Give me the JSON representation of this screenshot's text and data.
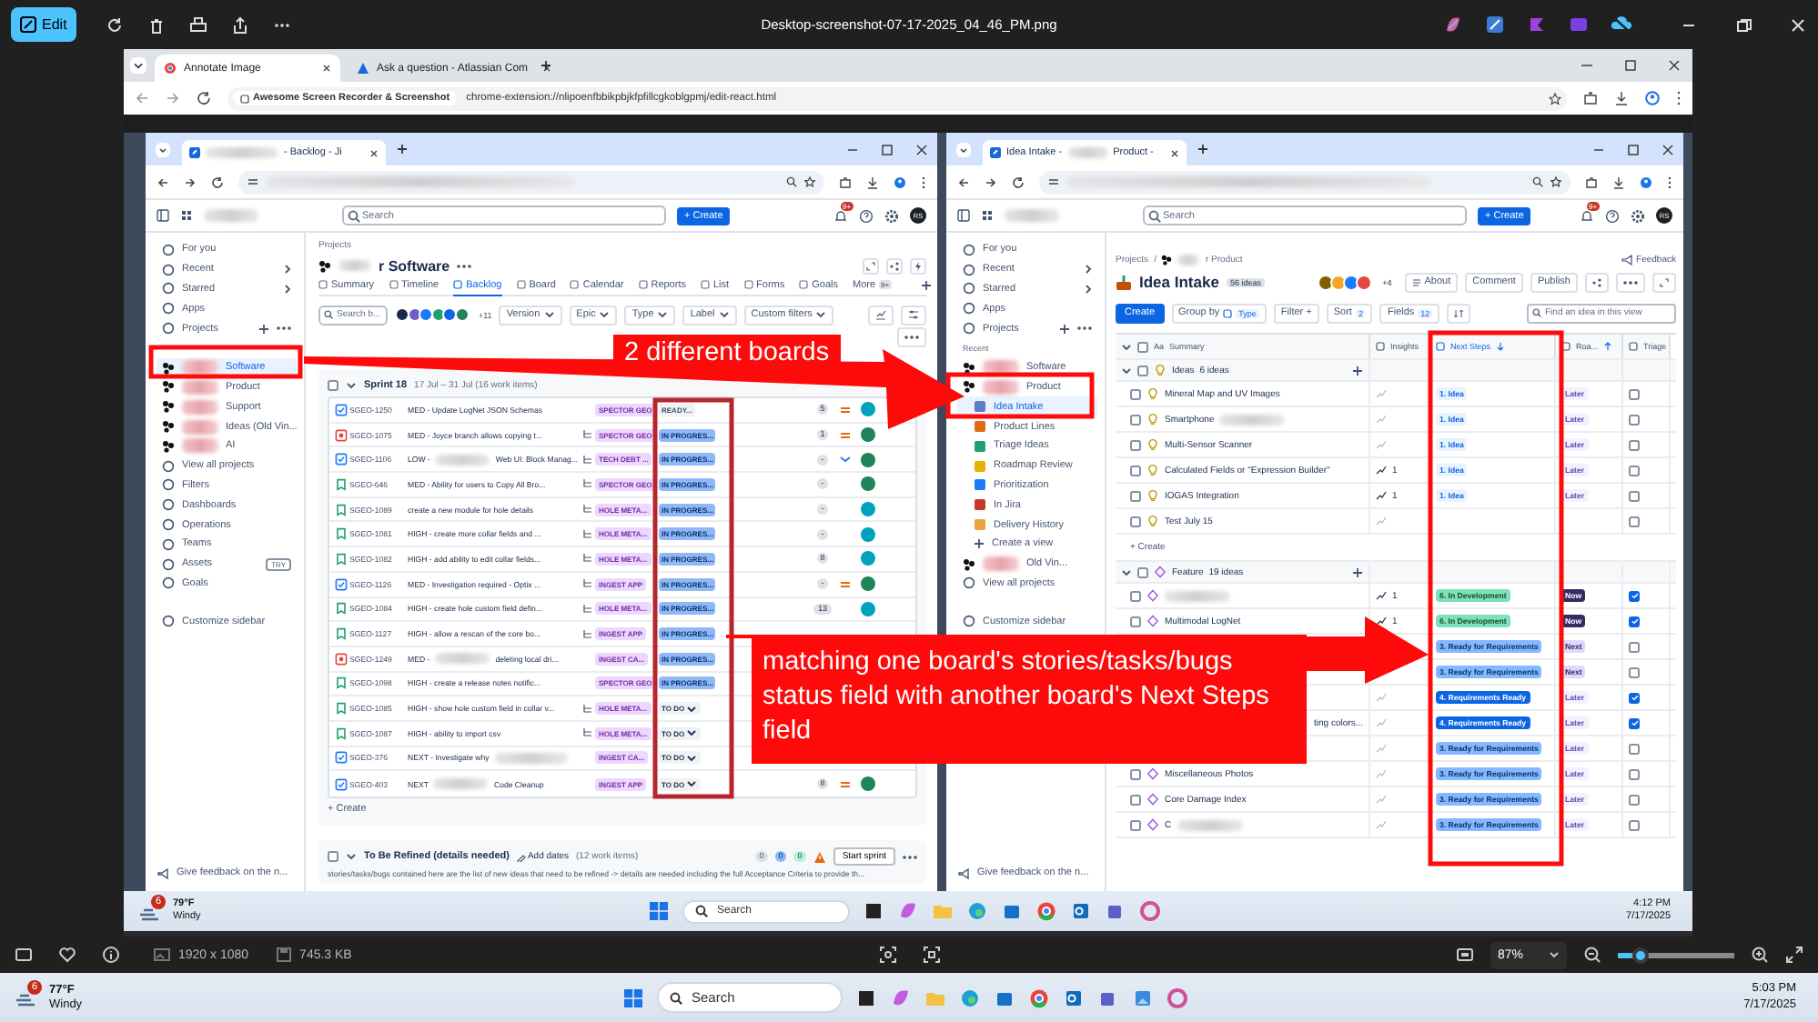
{
  "viewer": {
    "edit_button": "Edit",
    "title": "Desktop-screenshot-07-17-2025_04_46_PM.png",
    "dimensions": "1920 x 1080",
    "file_size": "745.3 KB",
    "zoom": "87%",
    "zoom_slider": {
      "level": 0.12
    }
  },
  "browser": {
    "tabs": [
      {
        "label": "Annotate Image",
        "selected": true
      },
      {
        "label": "Ask a question - Atlassian Com",
        "selected": false
      }
    ],
    "site_chip": "Awesome Screen Recorder & Screenshot",
    "url": "chrome-extension://nlipoenfbbikpbjkfpfillcgkoblgpmj/edit-react.html"
  },
  "left_window": {
    "tab_title": "- Backlog - Ji",
    "search": {
      "placeholder": "Search"
    },
    "create_button": "+ Create",
    "notification_count": "9+",
    "user_initials": "RS",
    "sidebar": [
      {
        "label": "For you",
        "kind": "link",
        "selected": false
      },
      {
        "label": "Recent",
        "kind": "menu",
        "selected": false
      },
      {
        "label": "Starred",
        "kind": "menu",
        "selected": false
      },
      {
        "label": "Apps",
        "kind": "link",
        "selected": false
      },
      {
        "label": "Projects",
        "kind": "section",
        "selected": false
      },
      {
        "label": "Software",
        "kind": "project",
        "selected": true
      },
      {
        "label": "Product",
        "kind": "project",
        "selected": false
      },
      {
        "label": "Support",
        "kind": "project",
        "selected": false
      },
      {
        "label": "Ideas (Old Vin...",
        "kind": "project",
        "selected": false
      },
      {
        "label": "AI",
        "kind": "project",
        "selected": false
      },
      {
        "label": "View all projects",
        "kind": "link",
        "selected": false
      },
      {
        "label": "Filters",
        "kind": "link",
        "selected": false
      },
      {
        "label": "Dashboards",
        "kind": "link",
        "selected": false
      },
      {
        "label": "Operations",
        "kind": "link",
        "selected": false
      },
      {
        "label": "Teams",
        "kind": "link",
        "selected": false
      },
      {
        "label": "Assets",
        "kind": "link",
        "badge": "TRY",
        "selected": false
      },
      {
        "label": "Goals",
        "kind": "link",
        "selected": false
      },
      {
        "label": "Customize sidebar",
        "kind": "link",
        "selected": false
      }
    ],
    "feedback": "Give feedback on the n...",
    "breadcrumb": "Projects",
    "project_title": "r Software",
    "tabs": [
      {
        "label": "Summary",
        "selected": false
      },
      {
        "label": "Timeline",
        "selected": false
      },
      {
        "label": "Backlog",
        "selected": true
      },
      {
        "label": "Board",
        "selected": false
      },
      {
        "label": "Calendar",
        "selected": false
      },
      {
        "label": "Reports",
        "selected": false
      },
      {
        "label": "List",
        "selected": false
      },
      {
        "label": "Forms",
        "selected": false
      },
      {
        "label": "Goals",
        "selected": false
      }
    ],
    "more_tab": {
      "label": "More",
      "badge": "9+"
    },
    "backlog_search": {
      "placeholder": "Search b..."
    },
    "avatars": [
      {
        "color": "#172b4d"
      },
      {
        "color": "#6e5dc6"
      },
      {
        "color": "#1d7afc"
      },
      {
        "color": "#22a06b"
      },
      {
        "color": "#0c66e4"
      },
      {
        "color": "#1f845a"
      }
    ],
    "avatar_overflow": "+11",
    "filters": [
      "Version",
      "Epic",
      "Type",
      "Label",
      "Custom filters"
    ],
    "sprint": {
      "name": "Sprint 18",
      "checked": false,
      "dates": "17 Jul – 31 Jul (16 work items)",
      "create": "+ Create",
      "rows": [
        {
          "kind": "task",
          "key": "SGEO-1250",
          "summary": "MED - Update LogNet JSON Schemas",
          "child_items": false,
          "epic": "SPECTOR GEO",
          "status": {
            "label": "READY...",
            "kind": "ready"
          },
          "estimate": "5",
          "priority": {
            "kind": "medium"
          },
          "assignee": {
            "color": "#00a3bf"
          }
        },
        {
          "kind": "bug",
          "key": "SGEO-1075",
          "summary": "MED - Joyce branch allows copying t...",
          "child_items": true,
          "epic": "SPECTOR GEO",
          "status": {
            "label": "IN PROGRES...",
            "kind": "inprogress"
          },
          "estimate": "1",
          "priority": {
            "kind": "medium"
          },
          "assignee": {
            "color": "#1f845a"
          }
        },
        {
          "kind": "task",
          "key": "SGEO-1106",
          "summary": "LOW -",
          "summary_tail": "Web UI: Block Manag...",
          "child_items": true,
          "epic": "TECH DEBT ...",
          "status": {
            "label": "IN PROGRES...",
            "kind": "inprogress"
          },
          "estimate": "-",
          "priority": {
            "kind": "low"
          },
          "assignee": {
            "color": "#1f845a"
          }
        },
        {
          "kind": "story",
          "key": "SGEO-646",
          "summary": "MED - Ability for users to Copy All Bro...",
          "child_items": true,
          "epic": "SPECTOR GEO",
          "status": {
            "label": "IN PROGRES...",
            "kind": "inprogress"
          },
          "estimate": "-",
          "assignee": {
            "color": "#1f845a"
          }
        },
        {
          "kind": "story",
          "key": "SGEO-1089",
          "summary": "create a new module for hole details",
          "child_items": true,
          "epic": "HOLE META...",
          "status": {
            "label": "IN PROGRES...",
            "kind": "inprogress"
          },
          "estimate": "-",
          "assignee": {
            "color": "#00a3bf"
          }
        },
        {
          "kind": "story",
          "key": "SGEO-1081",
          "summary": "HIGH - create more collar fields and ...",
          "child_items": true,
          "epic": "HOLE META...",
          "status": {
            "label": "IN PROGRES...",
            "kind": "inprogress"
          },
          "estimate": "-",
          "assignee": {
            "color": "#00a3bf"
          }
        },
        {
          "kind": "story",
          "key": "SGEO-1082",
          "summary": "HIGH - add ability to edit collar fields...",
          "child_items": true,
          "epic": "HOLE META...",
          "status": {
            "label": "IN PROGRES...",
            "kind": "inprogress"
          },
          "estimate": "8",
          "assignee": {
            "color": "#00a3bf"
          }
        },
        {
          "kind": "task",
          "key": "SGEO-1126",
          "summary": "MED - Investigation required - Optix ...",
          "child_items": true,
          "epic": "INGEST APP",
          "status": {
            "label": "IN PROGRES...",
            "kind": "inprogress"
          },
          "estimate": "-",
          "priority": {
            "kind": "medium"
          },
          "assignee": {
            "color": "#1f845a"
          }
        },
        {
          "kind": "story",
          "key": "SGEO-1084",
          "summary": "HIGH - create hole custom field defin...",
          "child_items": true,
          "epic": "HOLE META...",
          "status": {
            "label": "IN PROGRES...",
            "kind": "inprogress"
          },
          "estimate": "13",
          "assignee": {
            "color": "#00a3bf"
          }
        },
        {
          "kind": "story",
          "key": "SGEO-1127",
          "summary": "HIGH - allow a rescan of the core bo...",
          "child_items": true,
          "epic": "INGEST APP",
          "status": {
            "label": "IN PROGRES...",
            "kind": "inprogress"
          }
        },
        {
          "kind": "bug",
          "key": "SGEO-1249",
          "summary": "MED -",
          "summary_tail": "deleting local dri...",
          "child_items": false,
          "epic": "INGEST CA...",
          "status": {
            "label": "IN PROGRES...",
            "kind": "inprogress"
          }
        },
        {
          "kind": "story",
          "key": "SGEO-1098",
          "summary": "HIGH - create a release notes notific...",
          "child_items": false,
          "epic": "SPECTOR GEO",
          "status": {
            "label": "IN PROGRES...",
            "kind": "inprogress"
          }
        },
        {
          "kind": "story",
          "key": "SGEO-1085",
          "summary": "HIGH - show hole custom field in collar v...",
          "child_items": true,
          "epic": "HOLE META...",
          "status": {
            "label": "TO DO",
            "kind": "todo"
          }
        },
        {
          "kind": "story",
          "key": "SGEO-1087",
          "summary": "HIGH - ability to import csv",
          "child_items": true,
          "epic": "HOLE META...",
          "status": {
            "label": "TO DO",
            "kind": "todo"
          }
        },
        {
          "kind": "task",
          "key": "SGEO-376",
          "summary": "NEXT - Investigate why",
          "redacted": true,
          "child_items": false,
          "epic": "INGEST CA...",
          "status": {
            "label": "TO DO",
            "kind": "todo"
          }
        },
        {
          "kind": "task",
          "key": "SGEO-403",
          "summary": "NEXT",
          "summary_tail": "Code Cleanup",
          "child_items": false,
          "epic": "INGEST APP",
          "status": {
            "label": "TO DO",
            "kind": "todo"
          },
          "estimate": "8",
          "priority": {
            "kind": "medium"
          },
          "assignee": {
            "color": "#1f845a"
          }
        }
      ]
    },
    "next_sprint": {
      "name": "To Be Refined (details needed)",
      "checked": false,
      "add_dates": "Add dates",
      "count": "(12 work items)",
      "points": [
        "0",
        "0",
        "0"
      ],
      "start_button": "Start sprint",
      "description": "stories/tasks/bugs contained here are the list of new ideas that need to be refined -> details are needed including the full Acceptance Criteria to provide th..."
    }
  },
  "right_window": {
    "tab_title": "Idea Intake -",
    "tab_title_2": "Product -",
    "search": {
      "placeholder": "Search"
    },
    "create_button": "+ Create",
    "notification_count": "9+",
    "user_initials": "RS",
    "sidebar": [
      {
        "label": "For you",
        "kind": "link",
        "selected": false
      },
      {
        "label": "Recent",
        "kind": "menu",
        "selected": false
      },
      {
        "label": "Starred",
        "kind": "menu",
        "selected": false
      },
      {
        "label": "Apps",
        "kind": "link",
        "selected": false
      },
      {
        "label": "Projects",
        "kind": "section",
        "selected": false
      },
      {
        "label": "Recent",
        "kind": "heading"
      },
      {
        "label": "Software",
        "kind": "project",
        "selected": false
      },
      {
        "label": "Product",
        "kind": "project",
        "selected": false
      },
      {
        "label": "Idea Intake",
        "kind": "view",
        "selected": true
      },
      {
        "label": "Product Lines",
        "kind": "view",
        "selected": false
      },
      {
        "label": "Triage Ideas",
        "kind": "view",
        "selected": false
      },
      {
        "label": "Roadmap Review",
        "kind": "view",
        "selected": false
      },
      {
        "label": "Prioritization",
        "kind": "view",
        "selected": false
      },
      {
        "label": "In Jira",
        "kind": "view",
        "selected": false
      },
      {
        "label": "Delivery History",
        "kind": "view",
        "selected": false
      },
      {
        "label": "Create a view",
        "kind": "add",
        "selected": false
      },
      {
        "label": "Old Vin...",
        "kind": "project",
        "selected": false
      },
      {
        "label": "View all projects",
        "kind": "link",
        "selected": false
      },
      {
        "label": "Customize sidebar",
        "kind": "link",
        "selected": false
      }
    ],
    "feedback": "Give feedback on the n...",
    "breadcrumb_root": "Projects",
    "breadcrumb_separator": "/",
    "breadcrumb_project": "r Product",
    "feedback_link": "Feedback",
    "title": "Idea Intake",
    "idea_count": "56 ideas",
    "avatars": [
      {
        "color": "#7f5f01"
      },
      {
        "color": "#f5a623"
      },
      {
        "color": "#1d7afc"
      },
      {
        "color": "#e2483d"
      }
    ],
    "avatar_overflow": "+4",
    "actions": [
      "About",
      "Comment",
      "Publish"
    ],
    "toolbar": {
      "create": "Create",
      "group_by": "Group by",
      "group_value": "Type",
      "filter": "Filter +",
      "sort": "Sort",
      "sort_count": "2",
      "fields": "Fields",
      "fields_count": "12",
      "search": {
        "placeholder": "Find an idea in this view"
      }
    },
    "select_all": {
      "checked": false
    },
    "columns": [
      {
        "label": "Summary",
        "prefix": "Aa",
        "kind": "plain"
      },
      {
        "label": "Insights",
        "kind": "plain"
      },
      {
        "label": "Next Steps",
        "kind": "sorted_desc"
      },
      {
        "label": "Roa...",
        "kind": "sorted_asc"
      },
      {
        "label": "Triage",
        "kind": "plain"
      }
    ],
    "groups": [
      {
        "kind": "idea",
        "name": "Ideas",
        "count": "6 ideas",
        "expanded": true,
        "checked": false,
        "create": "+ Create",
        "rows": [
          {
            "checked": false,
            "summary": "Mineral Map and UV Images",
            "next_step": {
              "label": "1. Idea",
              "kind": "idea"
            },
            "roadmap": {
              "label": "Later",
              "kind": "later"
            },
            "triaged": false
          },
          {
            "checked": false,
            "summary": "Smartphone",
            "redacted": true,
            "next_step": {
              "label": "1. Idea",
              "kind": "idea"
            },
            "roadmap": {
              "label": "Later",
              "kind": "later"
            },
            "triaged": false
          },
          {
            "checked": false,
            "summary": "Multi-Sensor Scanner",
            "next_step": {
              "label": "1. Idea",
              "kind": "idea"
            },
            "roadmap": {
              "label": "Later",
              "kind": "later"
            },
            "triaged": false
          },
          {
            "checked": false,
            "summary": "Calculated Fields or \"Expression Builder\"",
            "insights": "1",
            "next_step": {
              "label": "1. Idea",
              "kind": "idea"
            },
            "roadmap": {
              "label": "Later",
              "kind": "later"
            },
            "triaged": false
          },
          {
            "checked": false,
            "summary": "IOGAS Integration",
            "insights": "1",
            "next_step": {
              "label": "1. Idea",
              "kind": "idea"
            },
            "roadmap": {
              "label": "Later",
              "kind": "later"
            },
            "triaged": false
          },
          {
            "checked": false,
            "summary": "Test July 15",
            "triaged": false
          }
        ]
      },
      {
        "kind": "feature",
        "name": "Feature",
        "count": "19 ideas",
        "expanded": true,
        "checked": false,
        "rows": [
          {
            "checked": false,
            "redacted": true,
            "insights": "1",
            "next_step": {
              "label": "6. In Development",
              "kind": "dev"
            },
            "roadmap": {
              "label": "Now",
              "kind": "now"
            },
            "triaged": true
          },
          {
            "checked": false,
            "summary": "Multimodal LogNet",
            "insights": "1",
            "next_step": {
              "label": "6. In Development",
              "kind": "dev"
            },
            "roadmap": {
              "label": "Now",
              "kind": "now"
            },
            "triaged": true
          },
          {
            "next_step": {
              "label": "3. Ready for Requirements",
              "kind": "ready"
            },
            "roadmap": {
              "label": "Next",
              "kind": "next"
            },
            "triaged": false
          },
          {
            "next_step": {
              "label": "3. Ready for Requirements",
              "kind": "ready"
            },
            "roadmap": {
              "label": "Next",
              "kind": "next"
            },
            "triaged": false
          },
          {
            "next_step": {
              "label": "4. Requirements Ready",
              "kind": "reqready"
            },
            "roadmap": {
              "label": "Later",
              "kind": "later"
            },
            "triaged": true
          },
          {
            "summary": "ting colors...",
            "clipped_start": true,
            "next_step": {
              "label": "4. Requirements Ready",
              "kind": "reqready"
            },
            "roadmap": {
              "label": "Later",
              "kind": "later"
            },
            "triaged": true
          },
          {
            "next_step": {
              "label": "3. Ready for Requirements",
              "kind": "ready"
            },
            "roadmap": {
              "label": "Later",
              "kind": "later"
            },
            "triaged": false
          },
          {
            "checked": false,
            "summary": "Miscellaneous Photos",
            "next_step": {
              "label": "3. Ready for Requirements",
              "kind": "ready"
            },
            "roadmap": {
              "label": "Later",
              "kind": "later"
            },
            "triaged": false
          },
          {
            "checked": false,
            "summary": "Core Damage Index",
            "next_step": {
              "label": "3. Ready for Requirements",
              "kind": "ready"
            },
            "roadmap": {
              "label": "Later",
              "kind": "later"
            },
            "triaged": false
          },
          {
            "checked": false,
            "summary": "C",
            "redacted": true,
            "next_step": {
              "label": "3. Ready for Requirements",
              "kind": "ready"
            },
            "roadmap": {
              "label": "Later",
              "kind": "later"
            },
            "triaged": false
          }
        ]
      }
    ]
  },
  "inner_taskbar": {
    "temperature": "79°F",
    "weather": "Windy",
    "weather_badge": "6",
    "search": {
      "placeholder": "Search"
    },
    "time": "4:12 PM",
    "date": "7/17/2025"
  },
  "taskbar": {
    "temperature": "77°F",
    "weather": "Windy",
    "weather_badge": "6",
    "search": {
      "placeholder": "Search"
    },
    "time": "5:03 PM",
    "date": "7/17/2025"
  },
  "annotations": {
    "callouts": [
      "2 different boards",
      "matching one board's stories/tasks/bugs status field with another board's Next Steps field"
    ]
  }
}
